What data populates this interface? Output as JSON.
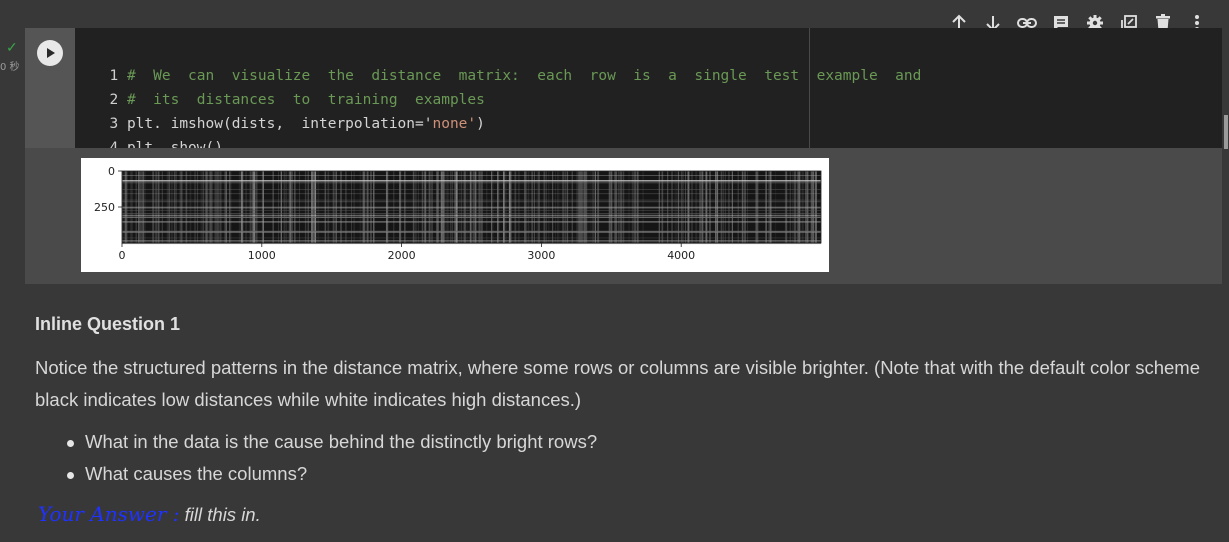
{
  "toolbar": {
    "icons": [
      "arrow-up-icon",
      "arrow-down-icon",
      "link-icon",
      "comment-icon",
      "gear-icon",
      "mirror-cell-icon",
      "trash-icon",
      "more-vert-icon"
    ]
  },
  "cell": {
    "status": "✓",
    "exec_time": "0 秒",
    "lines": [
      {
        "num": "1",
        "comment": "#  We  can  visualize  the  distance  matrix:  each  row  is  a  single  test  example  and"
      },
      {
        "num": "2",
        "comment": "#  its  distances  to  training  examples"
      },
      {
        "num": "3",
        "code_a": "plt. imshow(dists,  interpolation='",
        "code_str": "none'",
        "code_b": ")"
      },
      {
        "num": "4",
        "code_a": "plt. show()"
      }
    ]
  },
  "output": {
    "chart_data": {
      "type": "heatmap",
      "title": "",
      "xlabel": "",
      "ylabel": "",
      "x_ticks": [
        "0",
        "1000",
        "2000",
        "3000",
        "4000"
      ],
      "y_ticks": [
        "0",
        "250"
      ],
      "xlim": [
        0,
        5000
      ],
      "ylim": [
        0,
        500
      ],
      "colormap": "gray",
      "description_values": "distance values; black = low, white = high"
    }
  },
  "markdown": {
    "heading": "Inline Question 1",
    "paragraph": "Notice the structured patterns in the distance matrix, where some rows or columns are visible brighter. (Note that with the default color scheme black indicates low distances while white indicates high distances.)",
    "bullets": [
      "What in the data is the cause behind the distinctly bright rows?",
      "What causes the columns?"
    ],
    "answer_label": "Your Answer :",
    "answer_text": "fill this in."
  }
}
